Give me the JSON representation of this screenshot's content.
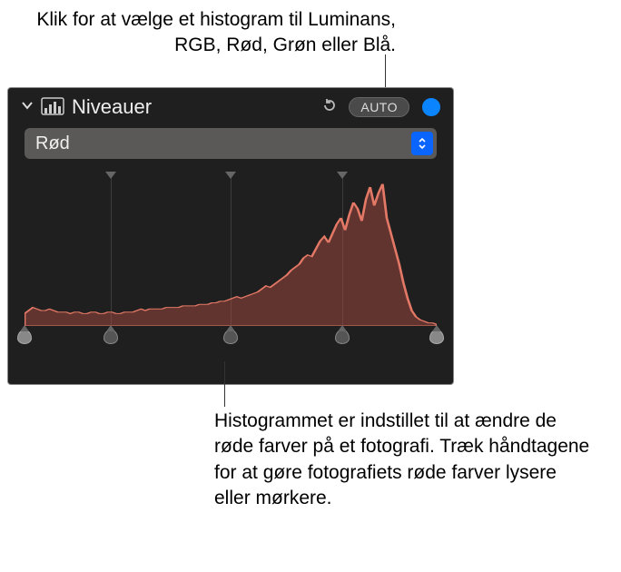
{
  "callouts": {
    "top": "Klik for at vælge et histogram til Luminans, RGB, Rød, Grøn eller Blå.",
    "bottom": "Histogrammet er indstillet til at ændre de røde farver på et fotografi. Træk håndtagene for at gøre fotografiets røde farver lysere eller mørkere."
  },
  "panel": {
    "title": "Niveauer",
    "auto_label": "AUTO",
    "channel_selected": "Rød"
  },
  "chart_data": {
    "type": "area",
    "title": "",
    "xlabel": "",
    "ylabel": "",
    "xlim": [
      0,
      100
    ],
    "ylim": [
      0,
      100
    ],
    "series": [
      {
        "name": "Rød",
        "color": "#d86a5a",
        "values": [
          8,
          10,
          12,
          11,
          10,
          10,
          11,
          10,
          9,
          9,
          9,
          8,
          9,
          9,
          8,
          8,
          9,
          9,
          8,
          8,
          9,
          9,
          8,
          8,
          9,
          9,
          9,
          10,
          11,
          10,
          11,
          11,
          11,
          11,
          12,
          12,
          12,
          12,
          13,
          13,
          13,
          13,
          14,
          14,
          14,
          15,
          15,
          16,
          16,
          17,
          18,
          19,
          18,
          19,
          20,
          21,
          22,
          24,
          26,
          25,
          27,
          29,
          31,
          33,
          36,
          38,
          40,
          44,
          46,
          45,
          50,
          55,
          58,
          54,
          60,
          66,
          70,
          62,
          72,
          80,
          76,
          68,
          82,
          90,
          78,
          86,
          92,
          70,
          60,
          50,
          40,
          28,
          18,
          10,
          6,
          4,
          3,
          2,
          2,
          1
        ]
      }
    ],
    "handles_pct": [
      0,
      21,
      50,
      77,
      100
    ],
    "grid_vlines_pct": [
      21,
      50,
      77
    ]
  }
}
